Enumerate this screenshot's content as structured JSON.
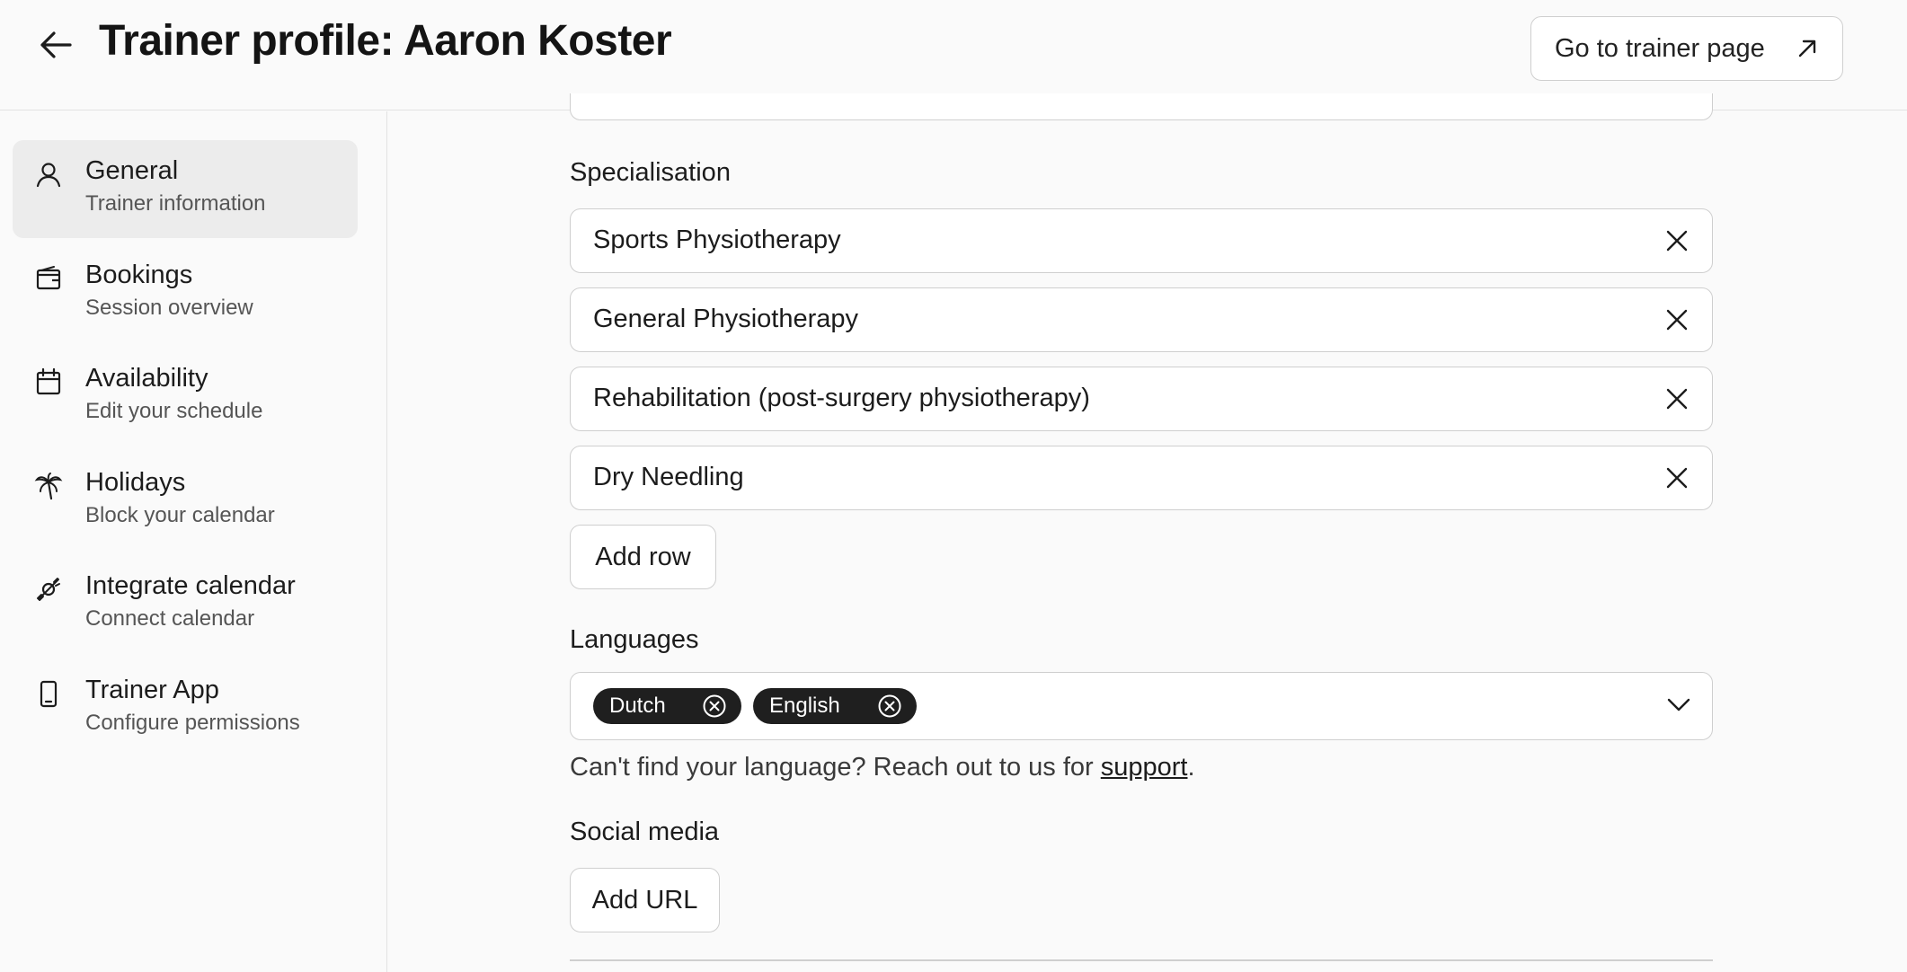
{
  "header": {
    "title": "Trainer profile: Aaron Koster",
    "trainer_page_button": "Go to trainer page"
  },
  "sidebar": {
    "items": [
      {
        "label": "General",
        "sub": "Trainer information",
        "icon": "user-icon",
        "active": true
      },
      {
        "label": "Bookings",
        "sub": "Session overview",
        "icon": "wallet-icon",
        "active": false
      },
      {
        "label": "Availability",
        "sub": "Edit your schedule",
        "icon": "calendar-icon",
        "active": false
      },
      {
        "label": "Holidays",
        "sub": "Block your calendar",
        "icon": "palm-tree-icon",
        "active": false
      },
      {
        "label": "Integrate calendar",
        "sub": "Connect calendar",
        "icon": "plug-icon",
        "active": false
      },
      {
        "label": "Trainer App",
        "sub": "Configure permissions",
        "icon": "phone-icon",
        "active": false
      }
    ]
  },
  "form": {
    "specialisation": {
      "label": "Specialisation",
      "rows": [
        "Sports Physiotherapy",
        "General Physiotherapy",
        "Rehabilitation (post-surgery physiotherapy)",
        "Dry Needling"
      ],
      "add_row_label": "Add row"
    },
    "languages": {
      "label": "Languages",
      "selected": [
        "Dutch",
        "English"
      ],
      "help_prefix": "Can't find your language? Reach out to us for ",
      "help_link": "support",
      "help_suffix": "."
    },
    "social_media": {
      "label": "Social media",
      "add_url_label": "Add URL"
    }
  },
  "colors": {
    "background": "#fafafa",
    "chip": "#1f1f1f",
    "active_nav": "#ececec",
    "border": "#cfcfcf"
  }
}
